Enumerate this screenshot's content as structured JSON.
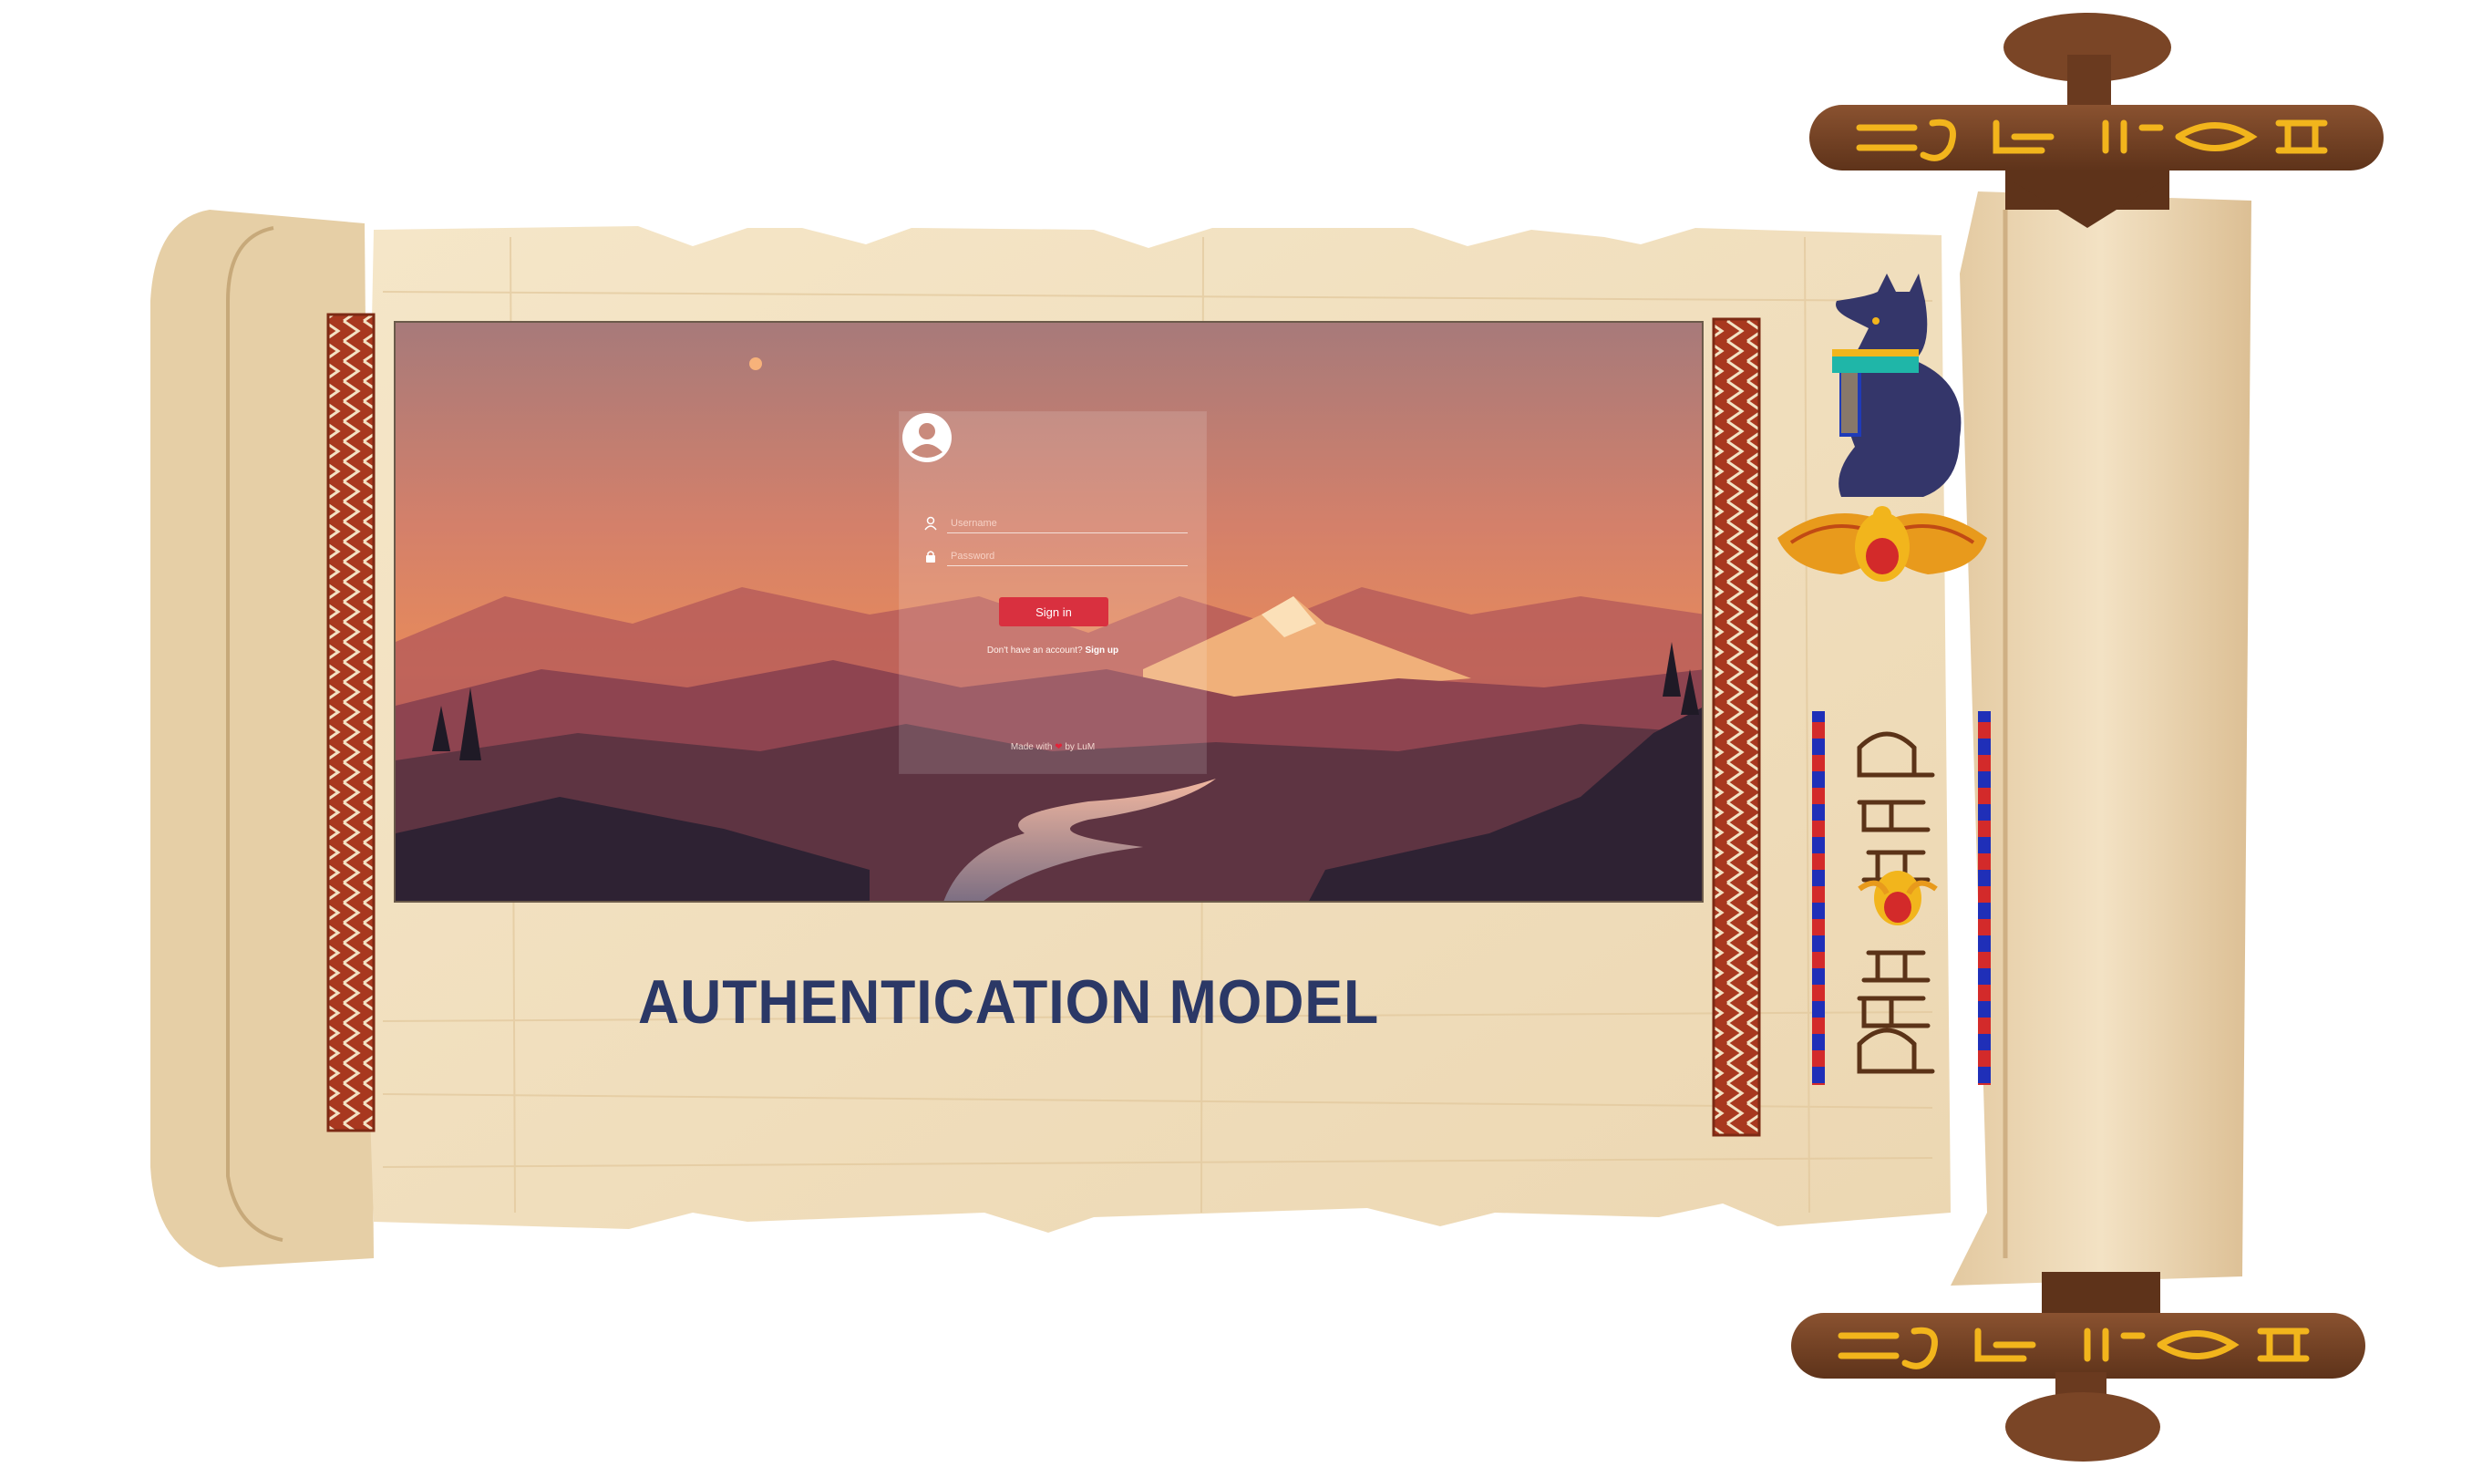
{
  "slide": {
    "title": "AUTHENTICATION MODEL"
  },
  "login": {
    "username_placeholder": "Username",
    "password_placeholder": "Password",
    "signin_label": "Sign in",
    "no_account_text": "Don't have an account?",
    "signup_label": "Sign up",
    "made_with_prefix": "Made with",
    "made_with_suffix": "by LuM"
  },
  "icons": {
    "avatar": "user-avatar-icon",
    "username": "user-icon",
    "password": "lock-icon",
    "heart": "heart-icon"
  },
  "colors": {
    "title": "#2b3866",
    "signin_button": "#d9303f",
    "papyrus": "#f0dfc0",
    "rod": "#7a4526",
    "hieroglyph_gold": "#f2b51c"
  }
}
